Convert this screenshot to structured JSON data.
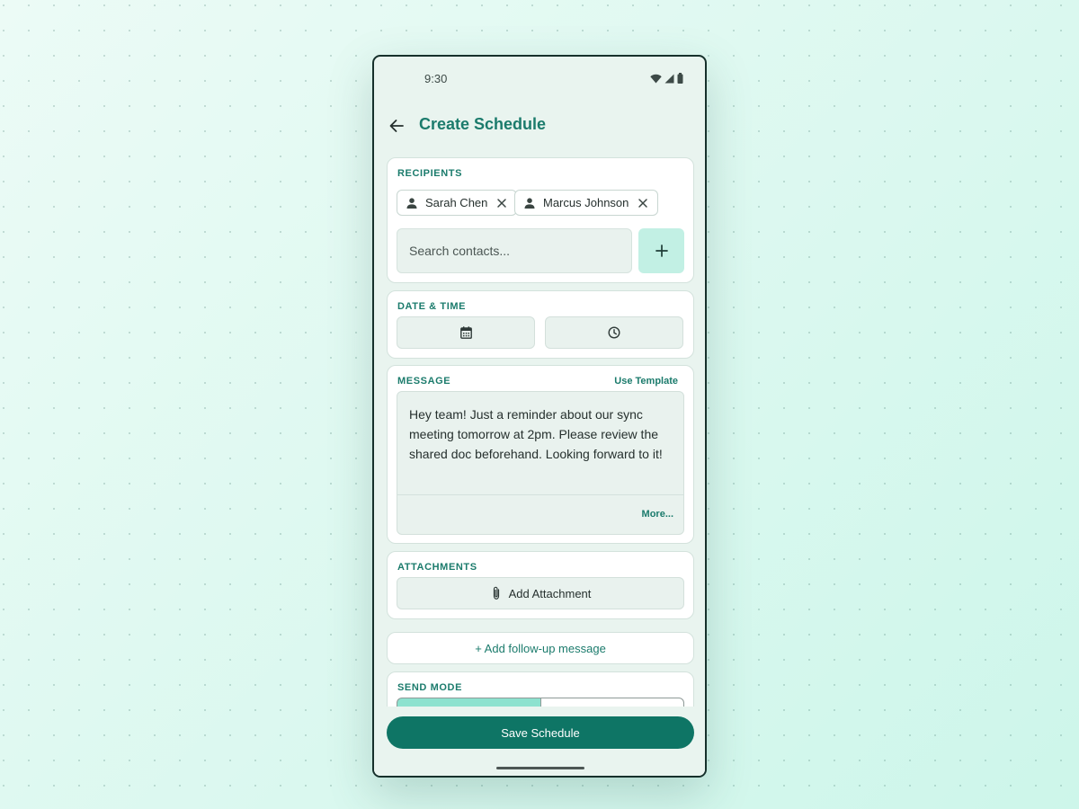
{
  "status_bar": {
    "time": "9:30",
    "icons": [
      "wifi-icon",
      "signal-icon",
      "battery-icon"
    ]
  },
  "app_bar": {
    "title": "Create Schedule",
    "back_icon": "arrow-left-icon"
  },
  "recipients": {
    "label": "RECIPIENTS",
    "chips": [
      {
        "name": "Sarah Chen",
        "icon": "person-icon"
      },
      {
        "name": "Marcus Johnson",
        "icon": "person-icon"
      }
    ],
    "search_placeholder": "Search contacts...",
    "add_icon": "plus-icon"
  },
  "date_time": {
    "label": "DATE & TIME",
    "date_icon": "calendar-icon",
    "time_icon": "clock-icon"
  },
  "message": {
    "label": "MESSAGE",
    "use_template": "Use Template",
    "text": "Hey team! Just a reminder about our sync meeting tomorrow at 2pm. Please review the shared doc beforehand. Looking forward to it!",
    "more": "More..."
  },
  "attachments": {
    "label": "ATTACHMENTS",
    "button": "Add Attachment",
    "icon": "paperclip-icon"
  },
  "followup": {
    "label": "+ Add follow-up message"
  },
  "send_mode": {
    "label": "SEND MODE"
  },
  "save": {
    "label": "Save Schedule"
  },
  "colors": {
    "primary": "#0e7565",
    "accent_text": "#1b7b6c",
    "accent_light": "#c2f0e4",
    "selected_segment": "#8de2cf",
    "surface": "#e9f4ef"
  }
}
